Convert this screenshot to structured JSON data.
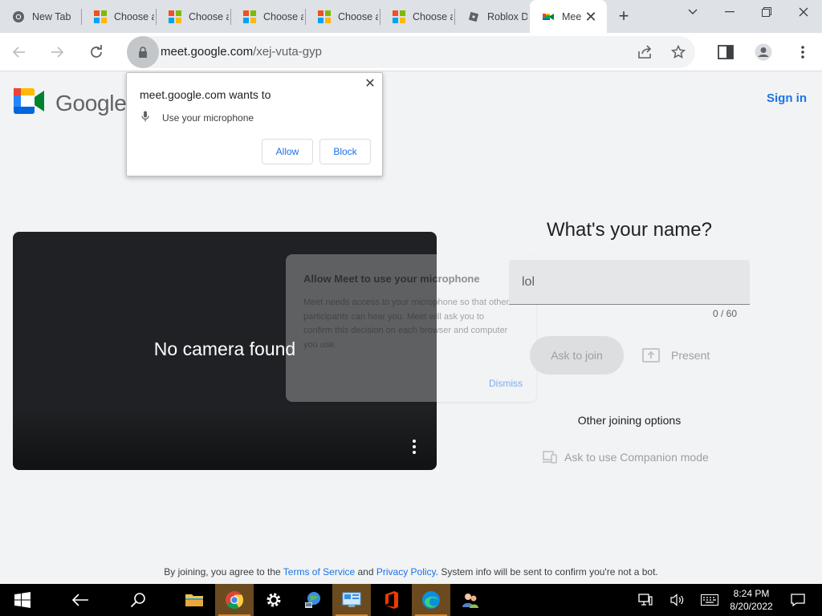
{
  "browser": {
    "tabs": [
      {
        "label": "New Tab",
        "icon": "chrome-icon"
      },
      {
        "label": "Choose a",
        "icon": "microsoft-icon"
      },
      {
        "label": "Choose a",
        "icon": "microsoft-icon"
      },
      {
        "label": "Choose a",
        "icon": "microsoft-icon"
      },
      {
        "label": "Choose a",
        "icon": "microsoft-icon"
      },
      {
        "label": "Choose a",
        "icon": "microsoft-icon"
      },
      {
        "label": "Roblox Du",
        "icon": "roblox-icon"
      },
      {
        "label": "Mee",
        "icon": "google-meet-icon",
        "active": true
      }
    ],
    "url_host": "meet.google.com",
    "url_path": "/xej-vuta-gyp"
  },
  "permission_popup": {
    "title": "meet.google.com wants to",
    "request": "Use your microphone",
    "allow_label": "Allow",
    "block_label": "Block"
  },
  "page": {
    "logo_text": "Google",
    "sign_in": "Sign in",
    "no_camera": "No camera found",
    "name_heading": "What's your name?",
    "name_value": "lol",
    "name_counter": "0 / 60",
    "ask_to_join": "Ask to join",
    "present": "Present",
    "other_options": "Other joining options",
    "companion": "Ask to use Companion mode",
    "dialog": {
      "title": "Allow Meet to use your microphone",
      "body": "Meet needs access to your microphone so that other participants can hear you. Meet will ask you to confirm this decision on each browser and computer you use.",
      "dismiss": "Dismiss"
    },
    "footer": {
      "prefix": "By joining, you agree to the",
      "terms": "Terms of Service",
      "and": "and",
      "privacy": "Privacy Policy",
      "suffix": ". System info will be sent to confirm you're not a bot."
    }
  },
  "taskbar": {
    "time": "8:24 PM",
    "date": "8/20/2022"
  },
  "colors": {
    "accent_blue": "#1a73e8",
    "taskbar_highlight": "#6b4a1f"
  }
}
